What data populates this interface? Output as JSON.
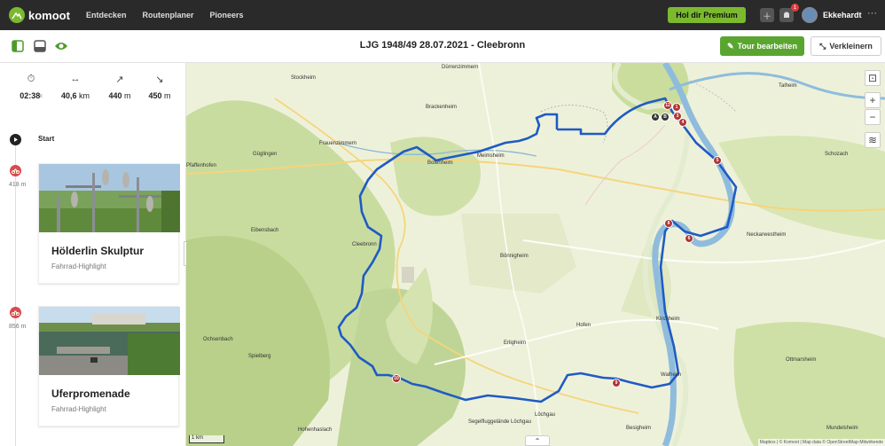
{
  "app": {
    "logo_text": "komoot",
    "nav": [
      "Entdecken",
      "Routenplaner",
      "Pioneers"
    ],
    "premium_label": "Hol dir Premium",
    "notification_count": "1",
    "username": "Ekkehardt",
    "more": "···"
  },
  "subbar": {
    "tour_title": "LJG 1948/49 28.07.2021 - Cleebronn",
    "edit_label": "Tour bearbeiten",
    "shrink_label": "Verkleinern"
  },
  "stats": {
    "duration": "02:38",
    "distance_value": "40,6",
    "distance_unit": "km",
    "up_value": "440",
    "up_unit": "m",
    "down_value": "450",
    "down_unit": "m"
  },
  "timeline": {
    "start_label": "Start",
    "items": [
      {
        "distance": "418 m",
        "title": "Hölderlin Skulptur",
        "subtitle": "Fahrrad-Highlight"
      },
      {
        "distance": "856 m",
        "title": "Uferpromenade",
        "subtitle": "Fahrrad-Highlight"
      }
    ]
  },
  "map": {
    "towns": [
      "Stockheim",
      "Dürrenzimmern",
      "Brackenheim",
      "Talheim",
      "Frauenzimmern",
      "Güglingen",
      "Botenheim",
      "Meimsheim",
      "Schozach",
      "Pfaffenhofen",
      "Eibensbach",
      "Cleebronn",
      "Neckarwestheim",
      "Bönnigheim",
      "Kirchheim",
      "Hofen",
      "Erligheim",
      "Ochsenbach",
      "Spielberg",
      "Ottmarsheim",
      "Walheim",
      "Löchgau",
      "Segelfluggelände Löchgau",
      "Hohenhaslach",
      "Besigheim",
      "Mundelsheim"
    ],
    "waypoints": [
      "12",
      "1",
      "3",
      "4",
      "5",
      "8",
      "6",
      "9",
      "10",
      "A",
      "B"
    ],
    "scale_label": "1 km",
    "attribution": "Mapbox | © Komoot | Map data © OpenStreetMap-Mitwirkende",
    "route_color": "#1f5bc4",
    "waypoint_color": "#b03434"
  }
}
